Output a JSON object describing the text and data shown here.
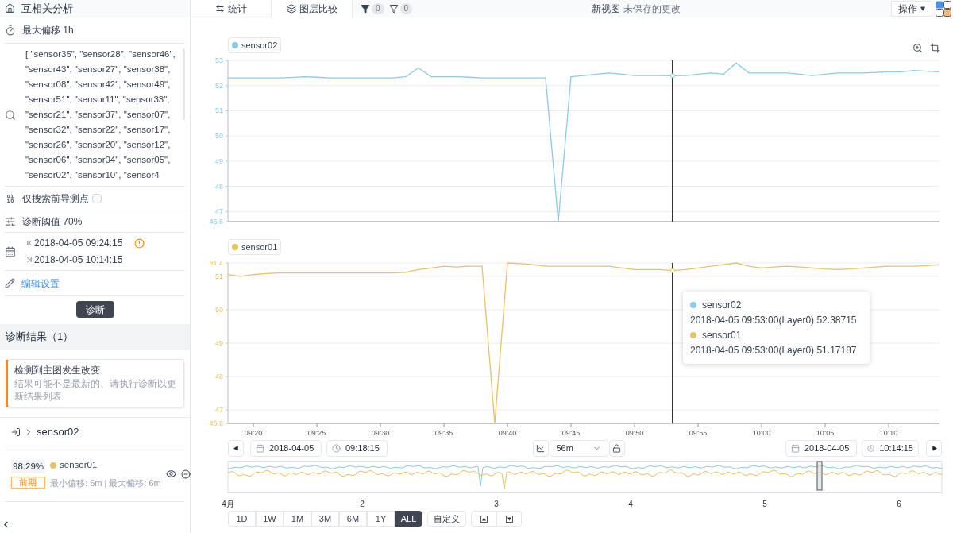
{
  "sidebar": {
    "title": "互相关分析",
    "max_offset": "最大偏移 1h",
    "search": {
      "value": "[ \"sensor35\", \"sensor28\", \"sensor46\", \"sensor43\", \"sensor27\", \"sensor38\", \"sensor08\", \"sensor42\", \"sensor49\", \"sensor51\", \"sensor11\", \"sensor33\", \"sensor21\", \"sensor37\", \"sensor07\", \"sensor32\", \"sensor22\", \"sensor17\", \"sensor26\", \"sensor20\", \"sensor12\", \"sensor06\", \"sensor04\", \"sensor05\", \"sensor02\", \"sensor10\", \"sensor4"
    },
    "lead_only": {
      "label": "仅搜索前导测点",
      "checked": false
    },
    "threshold": "诊断阈值 70%",
    "start": "2018-04-05 09:24:15",
    "end": "2018-04-05 10:14:15",
    "edit_link": "编辑设置",
    "diagnose_button": "诊断",
    "results_header": "诊断结果（1）",
    "alert": {
      "title": "检测到主图发生改变",
      "message": "结果可能不是最新的、请执行诊断以更新结果列表"
    },
    "target": "sensor02",
    "results": [
      {
        "score": "98.29%",
        "name": "sensor01",
        "color": "#e6c363",
        "tag": "前期",
        "detail": "最小偏移: 6m | 最大偏移: 6m"
      }
    ]
  },
  "topbar": {
    "tabs": [
      {
        "label": "统计",
        "selected": false
      },
      {
        "label": "图层比较",
        "selected": true
      }
    ],
    "filters": [
      {
        "kind": "filled",
        "count": "0"
      },
      {
        "kind": "outline",
        "count": "0"
      }
    ],
    "view_title": "新视图",
    "unsaved": "未保存的更改",
    "actions": "操作"
  },
  "charts": [
    {
      "chart_data": {
        "type": "line",
        "ylim": [
          46.6,
          53
        ],
        "yticks": [
          46.6,
          47,
          48,
          49,
          50,
          51,
          52,
          53
        ],
        "categories": [
          null,
          null,
          null,
          null,
          null,
          null,
          null,
          null,
          null,
          null,
          null,
          null,
          null,
          null,
          null,
          null,
          null,
          null,
          null,
          null,
          null,
          null,
          null,
          null,
          null,
          null,
          null,
          null,
          null,
          null,
          null,
          null,
          null,
          null,
          null,
          null,
          null,
          null,
          null,
          null,
          null,
          null,
          null,
          null,
          null,
          null,
          null,
          null,
          null,
          null,
          null,
          null,
          null,
          null,
          null,
          null,
          null
        ],
        "series": [
          {
            "name": "sensor02",
            "color": "#8ecae6",
            "values": [
              52.3,
              52.3,
              52.3,
              52.3,
              52.3,
              52.32,
              52.35,
              52.33,
              52.3,
              52.3,
              52.3,
              52.3,
              52.3,
              52.3,
              52.35,
              52.7,
              52.35,
              52.35,
              52.35,
              52.33,
              52.3,
              52.3,
              52.3,
              52.3,
              52.3,
              52.3,
              46.6,
              52.35,
              52.4,
              52.45,
              52.5,
              52.45,
              52.4,
              52.4,
              52.4,
              52.39,
              52.4,
              52.45,
              52.5,
              52.45,
              52.9,
              52.5,
              52.5,
              52.5,
              52.5,
              52.45,
              52.4,
              52.45,
              52.5,
              52.5,
              52.5,
              52.52,
              52.55,
              52.55,
              52.6,
              52.57,
              52.55
            ]
          }
        ],
        "grid": true
      }
    },
    {
      "chart_data": {
        "type": "line",
        "ylim": [
          46.6,
          51.4
        ],
        "yticks": [
          46.6,
          47,
          48,
          49,
          50,
          51,
          51.4
        ],
        "categories": [
          null,
          null,
          "09:20",
          null,
          null,
          null,
          null,
          "09:25",
          null,
          null,
          null,
          null,
          "09:30",
          null,
          null,
          null,
          null,
          "09:35",
          null,
          null,
          null,
          null,
          "09:40",
          null,
          null,
          null,
          null,
          "09:45",
          null,
          null,
          null,
          null,
          "09:50",
          null,
          null,
          null,
          null,
          "09:55",
          null,
          null,
          null,
          null,
          "10:00",
          null,
          null,
          null,
          null,
          "10:05",
          null,
          null,
          null,
          null,
          "10:10",
          null,
          null,
          null,
          null
        ],
        "series": [
          {
            "name": "sensor01",
            "color": "#e6c363",
            "values": [
              51.05,
              51.0,
              51.05,
              51.08,
              51.1,
              51.1,
              51.1,
              51.1,
              51.1,
              51.1,
              51.1,
              51.1,
              51.1,
              51.1,
              51.12,
              51.2,
              51.25,
              51.3,
              51.28,
              51.3,
              51.3,
              46.6,
              51.4,
              51.38,
              51.35,
              51.3,
              51.3,
              51.3,
              51.3,
              51.3,
              51.3,
              51.25,
              51.2,
              51.2,
              51.2,
              51.17,
              51.2,
              51.25,
              51.3,
              51.35,
              51.4,
              51.3,
              51.25,
              51.28,
              51.3,
              51.28,
              51.25,
              51.22,
              51.2,
              51.22,
              51.25,
              51.28,
              51.3,
              51.3,
              51.3,
              51.32,
              51.35
            ]
          }
        ],
        "grid": true
      }
    }
  ],
  "crosshair": {
    "level": 0.625
  },
  "tooltip": {
    "items": [
      {
        "name": "sensor02",
        "color": "#8ecae6",
        "text": "2018-04-05 09:53:00(Layer0) 52.38715"
      },
      {
        "name": "sensor01",
        "color": "#e6c363",
        "text": "2018-04-05 09:53:00(Layer0) 51.17187"
      }
    ]
  },
  "time_controls": {
    "start_date": "2018-04-05",
    "start_time": "09:18:15",
    "window": "56m",
    "end_date": "2018-04-05",
    "end_time": "10:14:15"
  },
  "navigator": {
    "labels": [
      "4月",
      "2",
      "3",
      "4",
      "5",
      "6"
    ]
  },
  "ranges": [
    {
      "label": "1D",
      "selected": false
    },
    {
      "label": "1W",
      "selected": false
    },
    {
      "label": "1M",
      "selected": false
    },
    {
      "label": "3M",
      "selected": false
    },
    {
      "label": "6M",
      "selected": false
    },
    {
      "label": "1Y",
      "selected": false
    },
    {
      "label": "ALL",
      "selected": true
    }
  ],
  "custom_button": "自定义"
}
